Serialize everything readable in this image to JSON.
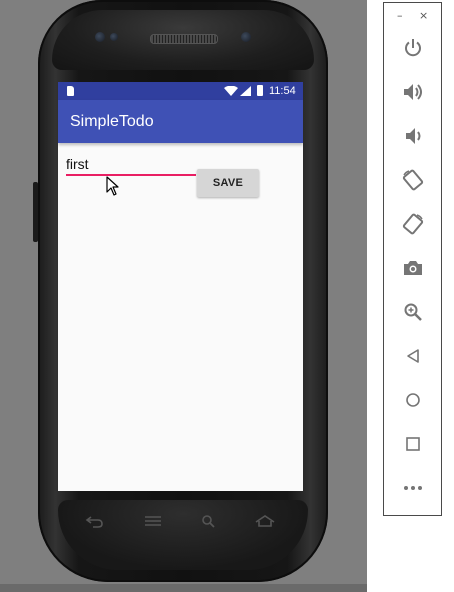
{
  "app": {
    "title": "SimpleTodo"
  },
  "status_bar": {
    "time": "11:54",
    "icons": [
      "sd-card-icon",
      "wifi-icon",
      "signal-icon",
      "battery-icon"
    ]
  },
  "form": {
    "item_value": "first",
    "save_label": "SAVE"
  },
  "emulator_toolbar": {
    "window_controls": [
      "–",
      "×"
    ],
    "tools": [
      "power-icon",
      "volume-up-icon",
      "volume-down-icon",
      "rotate-left-icon",
      "rotate-right-icon",
      "camera-icon",
      "zoom-icon",
      "back-icon",
      "home-icon",
      "overview-icon",
      "more-icon"
    ]
  },
  "colors": {
    "status_bar": "#303f9f",
    "app_bar": "#3f51b5",
    "input_underline": "#e91e63",
    "screen_bg": "#fafafa",
    "backdrop": "#7f7f7f",
    "tool_icon": "#757575"
  }
}
